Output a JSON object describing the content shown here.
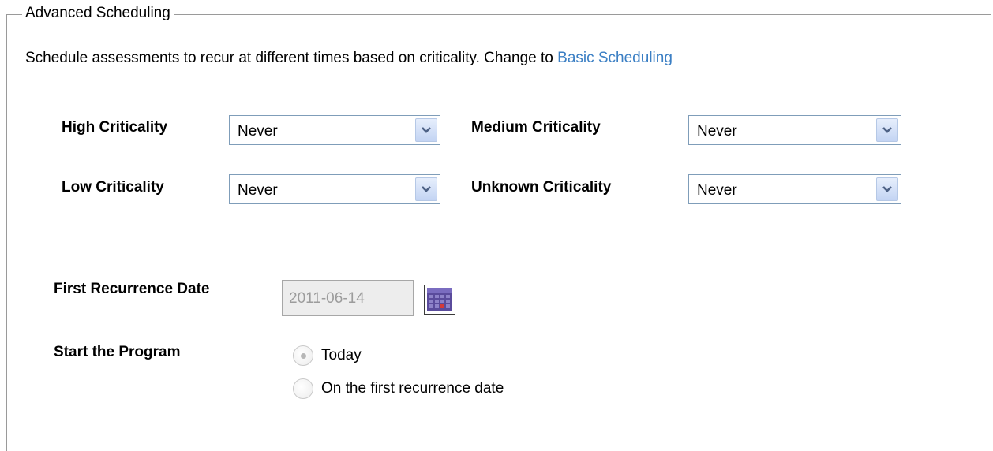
{
  "group": {
    "legend": "Advanced Scheduling"
  },
  "description": {
    "text": "Schedule assessments to recur at different times based on criticality. Change to ",
    "link": "Basic Scheduling"
  },
  "criticality": {
    "high": {
      "label": "High Criticality",
      "value": "Never"
    },
    "medium": {
      "label": "Medium Criticality",
      "value": "Never"
    },
    "low": {
      "label": "Low Criticality",
      "value": "Never"
    },
    "unknown": {
      "label": "Unknown Criticality",
      "value": "Never"
    }
  },
  "first_recurrence": {
    "label": "First Recurrence Date",
    "value": "2011-06-14",
    "icon": "calendar-icon"
  },
  "start_program": {
    "label": "Start the Program",
    "options": [
      {
        "label": "Today",
        "selected": true
      },
      {
        "label": "On the first recurrence date",
        "selected": false
      }
    ]
  },
  "colors": {
    "link": "#3b7fc4",
    "select_border": "#7f9db9",
    "frame": "#9a9a9a"
  }
}
